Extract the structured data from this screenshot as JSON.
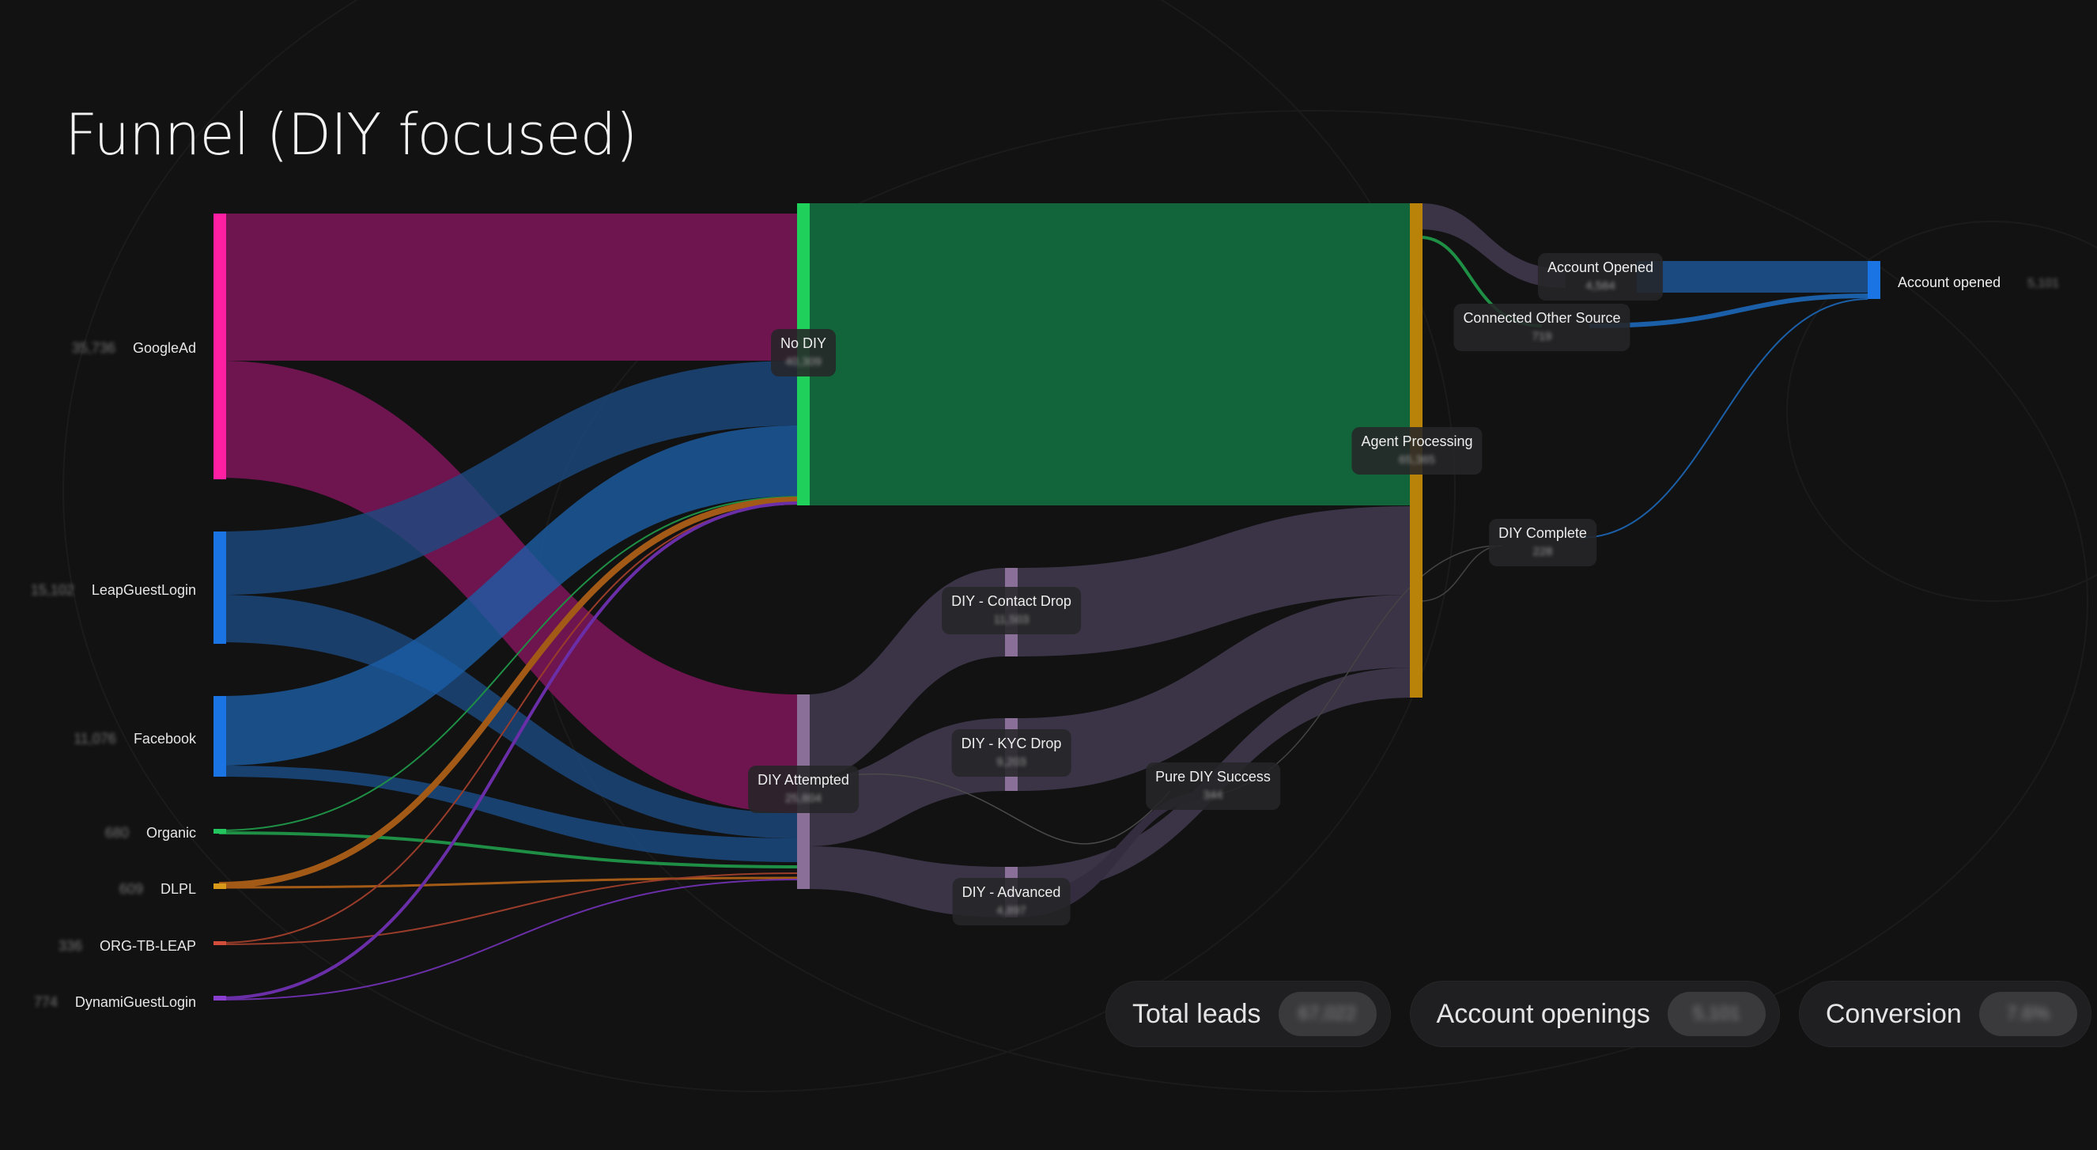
{
  "title": "Funnel (DIY focused)",
  "sources": [
    {
      "label": "GoogleAd",
      "value": "35,736",
      "color": "#ff1fa2"
    },
    {
      "label": "LeapGuestLogin",
      "value": "15,102",
      "color": "#1b74e4"
    },
    {
      "label": "Facebook",
      "value": "11,076",
      "color": "#1b74e4"
    },
    {
      "label": "Organic",
      "value": "680",
      "color": "#22c55e"
    },
    {
      "label": "DLPL",
      "value": "609",
      "color": "#d99a1a"
    },
    {
      "label": "ORG-TB-LEAP",
      "value": "336",
      "color": "#d24d3a"
    },
    {
      "label": "DynamiGuestLogin",
      "value": "774",
      "color": "#8b3fd1"
    }
  ],
  "nodes": {
    "no_diy": {
      "label": "No DIY",
      "value": "40,309"
    },
    "diy_attempted": {
      "label": "DIY Attempted",
      "value": "25,804"
    },
    "diy_contact_drop": {
      "label": "DIY - Contact Drop",
      "value": "11,503"
    },
    "diy_kyc_drop": {
      "label": "DIY - KYC Drop",
      "value": "9,203"
    },
    "diy_advanced": {
      "label": "DIY - Advanced",
      "value": "4,897"
    },
    "pure_diy_success": {
      "label": "Pure DIY Success",
      "value": "344"
    },
    "agent_processing": {
      "label": "Agent Processing",
      "value": "65,365"
    },
    "account_opened_mid": {
      "label": "Account Opened",
      "value": "4,564"
    },
    "connected_other_source": {
      "label": "Connected Other Source",
      "value": "719"
    },
    "diy_complete": {
      "label": "DIY Complete",
      "value": "228"
    },
    "account_opened_final": {
      "label": "Account opened",
      "value": "5,101"
    }
  },
  "stats": [
    {
      "label": "Total leads",
      "value": "67,022"
    },
    {
      "label": "Account openings",
      "value": "5,101"
    },
    {
      "label": "Conversion",
      "value": "7.6%"
    }
  ],
  "colors": {
    "google_flow": "#6e1550",
    "blue_flow": "#1b4a80",
    "diy_flow": "#3b3346",
    "no_diy_block": "#12643a",
    "node_no_diy": "#1fd15a",
    "node_agent": "#b98208",
    "node_diy": "#8a7099",
    "node_final": "#1b74e4"
  }
}
